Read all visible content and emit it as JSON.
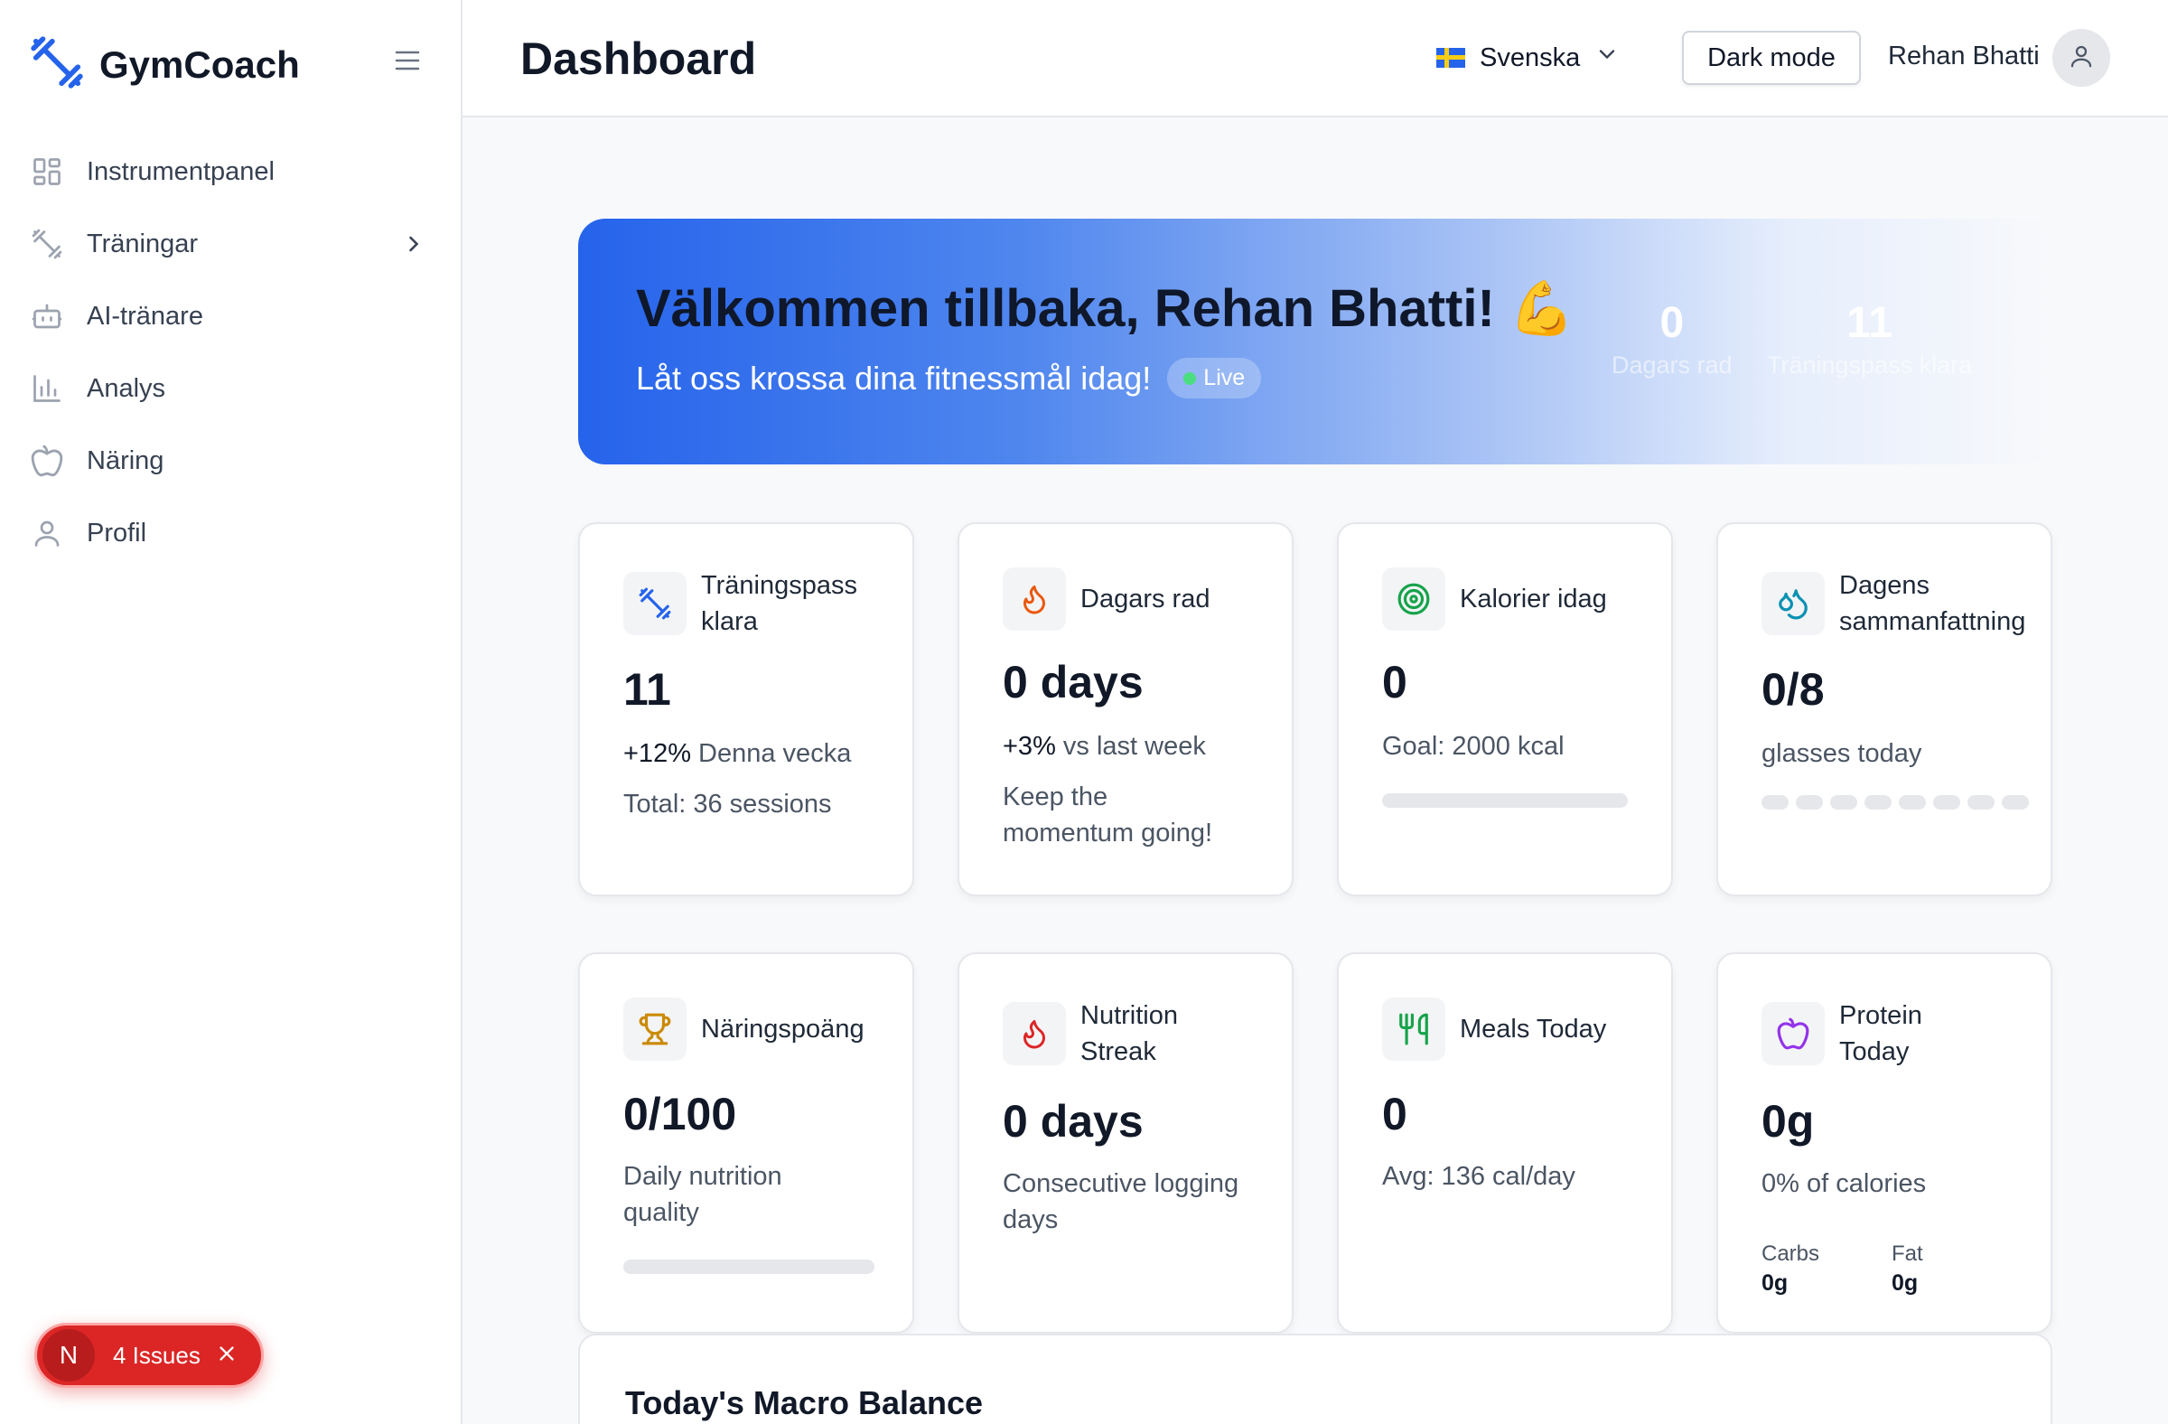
{
  "app": {
    "name": "GymCoach"
  },
  "sidebar": {
    "items": [
      {
        "label": "Instrumentpanel",
        "icon": "grid-icon"
      },
      {
        "label": "Träningar",
        "icon": "dumbbell-icon"
      },
      {
        "label": "AI-tränare",
        "icon": "robot-icon"
      },
      {
        "label": "Analys",
        "icon": "bar-chart-icon"
      },
      {
        "label": "Näring",
        "icon": "apple-icon"
      },
      {
        "label": "Profil",
        "icon": "user-icon"
      }
    ],
    "issues": {
      "badge": "N",
      "label": "4 Issues"
    }
  },
  "header": {
    "title": "Dashboard",
    "language": "Svenska",
    "dark_mode": "Dark mode",
    "user": "Rehan Bhatti"
  },
  "hero": {
    "title": "Välkommen tillbaka, Rehan Bhatti! 💪",
    "subtitle": "Låt oss krossa dina fitnessmål idag!",
    "live": "Live",
    "stats": [
      {
        "value": "0",
        "label": "Dagars rad"
      },
      {
        "value": "11",
        "label": "Träningspass klara"
      }
    ]
  },
  "cards": {
    "workouts": {
      "title1": "Träningspass",
      "title2": "klara",
      "value": "11",
      "delta": "+12%",
      "delta_label": "Denna vecka",
      "total": "Total: 36 sessions"
    },
    "streak": {
      "title": "Dagars rad",
      "value": "0 days",
      "delta": "+3%",
      "delta_label": "vs last week",
      "note1": "Keep the",
      "note2": "momentum going!"
    },
    "calories": {
      "title": "Kalorier idag",
      "value": "0",
      "goal": "Goal: 2000 kcal",
      "progress": 0
    },
    "summary": {
      "title1": "Dagens",
      "title2": "sammanfattning",
      "value": "0/8",
      "caption": "glasses today",
      "filled": 0,
      "total": 8
    },
    "nutrition_score": {
      "title": "Näringspoäng",
      "value": "0/100",
      "line1": "Daily nutrition",
      "line2": "quality",
      "progress": 0
    },
    "nutrition_streak": {
      "title1": "Nutrition",
      "title2": "Streak",
      "value": "0 days",
      "line1": "Consecutive logging",
      "line2": "days"
    },
    "meals": {
      "title": "Meals Today",
      "value": "0",
      "avg": "Avg: 136 cal/day"
    },
    "protein": {
      "title1": "Protein",
      "title2": "Today",
      "value": "0g",
      "pct": "0% of calories",
      "carbs_label": "Carbs",
      "carbs": "0g",
      "fat_label": "Fat",
      "fat": "0g"
    }
  },
  "macro": {
    "title": "Today's Macro Balance"
  },
  "colors": {
    "primary": "#2563eb",
    "danger": "#dc2626",
    "success": "#4ade80"
  }
}
